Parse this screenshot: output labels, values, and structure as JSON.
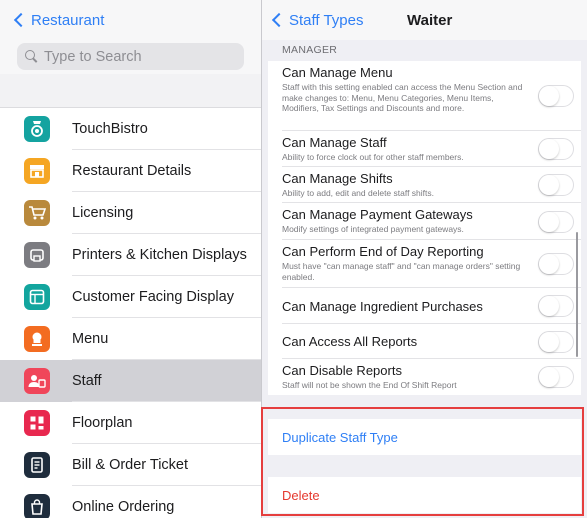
{
  "sidebar": {
    "back_label": "Restaurant",
    "search_placeholder": "Type to Search",
    "items": [
      {
        "label": "TouchBistro",
        "icon": "touchbistro-icon",
        "color": "#14a3a0"
      },
      {
        "label": "Restaurant Details",
        "icon": "storefront-icon",
        "color": "#f5a623"
      },
      {
        "label": "Licensing",
        "icon": "cart-icon",
        "color": "#b9893c"
      },
      {
        "label": "Printers & Kitchen Displays",
        "icon": "printer-icon",
        "color": "#7c7c81"
      },
      {
        "label": "Customer Facing Display",
        "icon": "display-icon",
        "color": "#12a59e"
      },
      {
        "label": "Menu",
        "icon": "chef-hat-icon",
        "color": "#f36c21"
      },
      {
        "label": "Staff",
        "icon": "staff-icon",
        "color": "#f0465a",
        "selected": true
      },
      {
        "label": "Floorplan",
        "icon": "floorplan-icon",
        "color": "#e8284f"
      },
      {
        "label": "Bill & Order Ticket",
        "icon": "ticket-icon",
        "color": "#1f2d3d"
      },
      {
        "label": "Online Ordering",
        "icon": "shopping-bag-icon",
        "color": "#1f2d3d"
      }
    ]
  },
  "main": {
    "back_label": "Staff Types",
    "title": "Waiter",
    "section": "MANAGER",
    "settings": [
      {
        "title": "Can Manage Menu",
        "subtitle": "Staff with this setting enabled can access the Menu Section and make changes to: Menu, Menu Categories, Menu Items, Modifiers, Tax Settings and Discounts and more.",
        "enabled": false
      },
      {
        "title": "Can Manage Staff",
        "subtitle": "Ability to force clock out for other staff members.",
        "enabled": false
      },
      {
        "title": "Can Manage Shifts",
        "subtitle": "Ability to add, edit and delete staff shifts.",
        "enabled": false
      },
      {
        "title": "Can Manage Payment Gateways",
        "subtitle": "Modify settings of integrated payment gateways.",
        "enabled": false
      },
      {
        "title": "Can Perform End of Day Reporting",
        "subtitle": "Must have \"can manage staff\" and \"can manage orders\" setting enabled.",
        "enabled": false
      },
      {
        "title": "Can Manage Ingredient Purchases",
        "subtitle": "",
        "enabled": false
      },
      {
        "title": "Can Access All Reports",
        "subtitle": "",
        "enabled": false
      },
      {
        "title": "Can Disable Reports",
        "subtitle": "Staff will not be shown the End Of Shift Report",
        "enabled": false
      }
    ],
    "duplicate_label": "Duplicate Staff Type",
    "delete_label": "Delete"
  },
  "colors": {
    "accent": "#2f7ff5",
    "destructive": "#e5392f",
    "highlight_box": "#e53e3e"
  }
}
